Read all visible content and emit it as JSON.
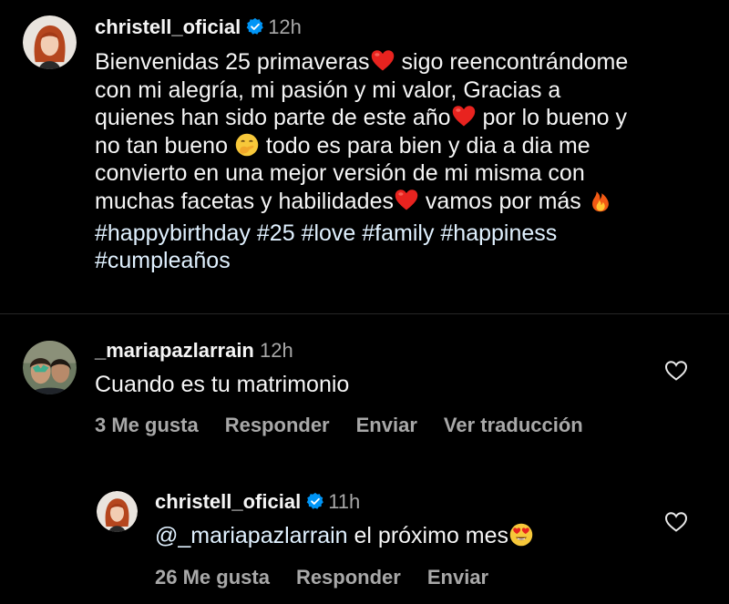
{
  "colors": {
    "background": "#000000",
    "text": "#f5f5f5",
    "secondary_text": "#a8a8a8",
    "link": "#e0f1ff",
    "verified": "#0095f6",
    "divider": "#262626"
  },
  "caption": {
    "username": "christell_oficial",
    "verified": true,
    "time": "12h",
    "lines": [
      [
        "Bienvenidas 25 primaveras",
        " sigo reencontrándome"
      ],
      [
        "con mi alegría, mi pasión y mi valor, Gracias a"
      ],
      [
        "quienes han sido parte de este año",
        " por lo bueno y"
      ],
      [
        "no tan bueno ",
        " todo es para bien y dia a dia me"
      ],
      [
        "convierto en una mejor versión de mi misma con"
      ],
      [
        "muchas facetas y habilidades",
        " vamos por más "
      ]
    ],
    "emojis": [
      "red-heart",
      "red-heart",
      "face-with-hand-over-mouth",
      "red-heart",
      "fire"
    ],
    "hashtags_line1": "#happybirthday #25 #love #family #happiness",
    "hashtags_line2": "#cumpleaños"
  },
  "comment": {
    "username": "_mariapazlarrain",
    "time": "12h",
    "text": "Cuando es tu matrimonio",
    "likes": "3 Me gusta",
    "reply_label": "Responder",
    "send_label": "Enviar",
    "translate_label": "Ver traducción"
  },
  "reply": {
    "username": "christell_oficial",
    "verified": true,
    "time": "11h",
    "mention": "@_mariapazlarrain",
    "text": " el próximo mes",
    "emoji": "smiling-face-with-heart-eyes",
    "likes": "26 Me gusta",
    "reply_label": "Responder",
    "send_label": "Enviar"
  }
}
